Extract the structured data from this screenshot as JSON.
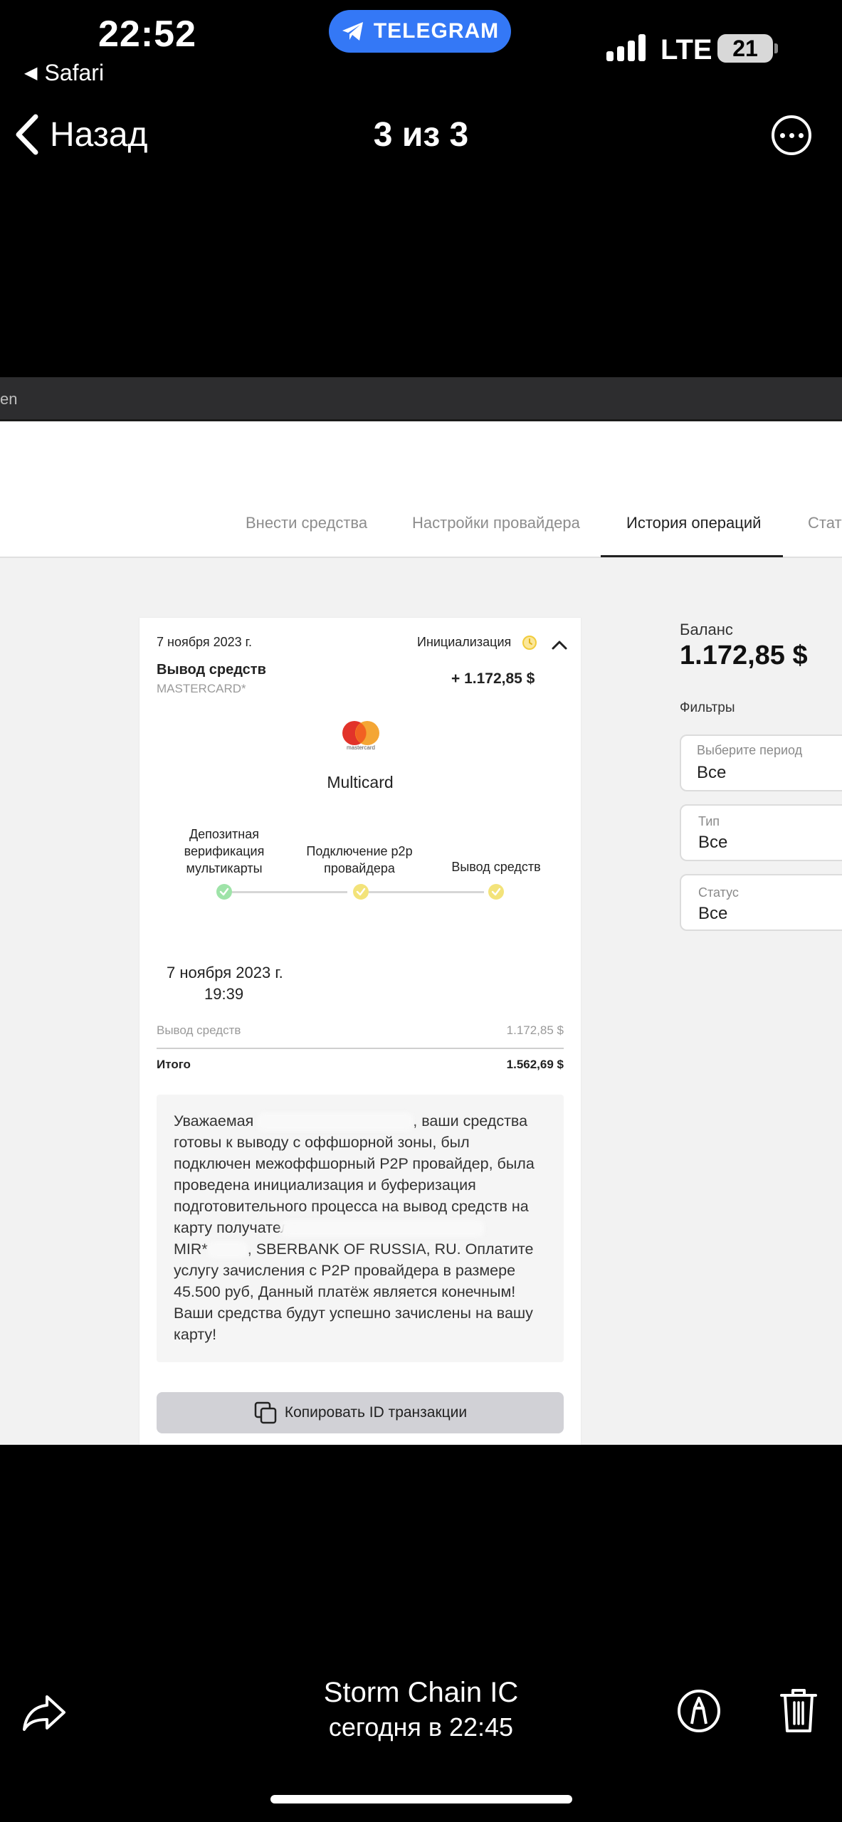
{
  "status_bar": {
    "time": "22:52",
    "back_app": "Safari",
    "pill_label": "TELEGRAM",
    "network": "LTE",
    "battery": "21"
  },
  "nav": {
    "back_label": "Назад",
    "title": "3 из 3"
  },
  "browser": {
    "url_fragment": "en"
  },
  "tabs": [
    {
      "label": "Внести средства"
    },
    {
      "label": "Настройки провайдера"
    },
    {
      "label": "История операций"
    },
    {
      "label": "Стат"
    }
  ],
  "card": {
    "date": "7 ноября 2023 г.",
    "status": "Инициализация",
    "title": "Вывод средств",
    "card_type": "MASTERCARD*",
    "amount": "+ 1.172,85 $",
    "logo_caption": "mastercard",
    "provider": "Multicard",
    "steps": [
      {
        "label": "Депозитная верификация мультикарты",
        "color": "#9ee3a8"
      },
      {
        "label": "Подключение p2p провайдера",
        "color": "#f3e37a"
      },
      {
        "label": "Вывод средств",
        "color": "#f3e37a"
      }
    ],
    "datetime_line1": "7 ноября 2023 г.",
    "datetime_line2": "19:39",
    "row_label": "Вывод средств",
    "row_value": "1.172,85 $",
    "total_label": "Итого",
    "total_value": "1.562,69 $",
    "notice": {
      "l1a": "Уважаемая",
      "l1b": ", ваши средства",
      "l2": "готовы к выводу с оффшорной зоны, был",
      "l3": "подключен межоффшорный P2P провайдер, была",
      "l4": "проведена инициализация и буферизация",
      "l5": "подготовительного процесса на вывод средств на",
      "l6": "карту получателя",
      "l7a": "MIR*",
      "l7b": ", SBERBANK OF RUSSIA, RU. Оплатите",
      "l8": "услугу зачисления с P2P провайдера в размере",
      "l9": "45.500 руб, Данный платёж является конечным!",
      "l10": "Ваши средства будут успешно зачислены на вашу",
      "l11": "карту!"
    },
    "copy_button": "Копировать ID транзакции"
  },
  "sidebar": {
    "balance_label": "Баланс",
    "balance_value": "1.172,85 $",
    "filters_label": "Фильтры",
    "filters": [
      {
        "caption": "Выберите период",
        "value": "Все"
      },
      {
        "caption": "Тип",
        "value": "Все"
      },
      {
        "caption": "Статус",
        "value": "Все"
      }
    ]
  },
  "caption": {
    "title": "Storm Chain IC",
    "subtitle": "сегодня в 22:45"
  }
}
